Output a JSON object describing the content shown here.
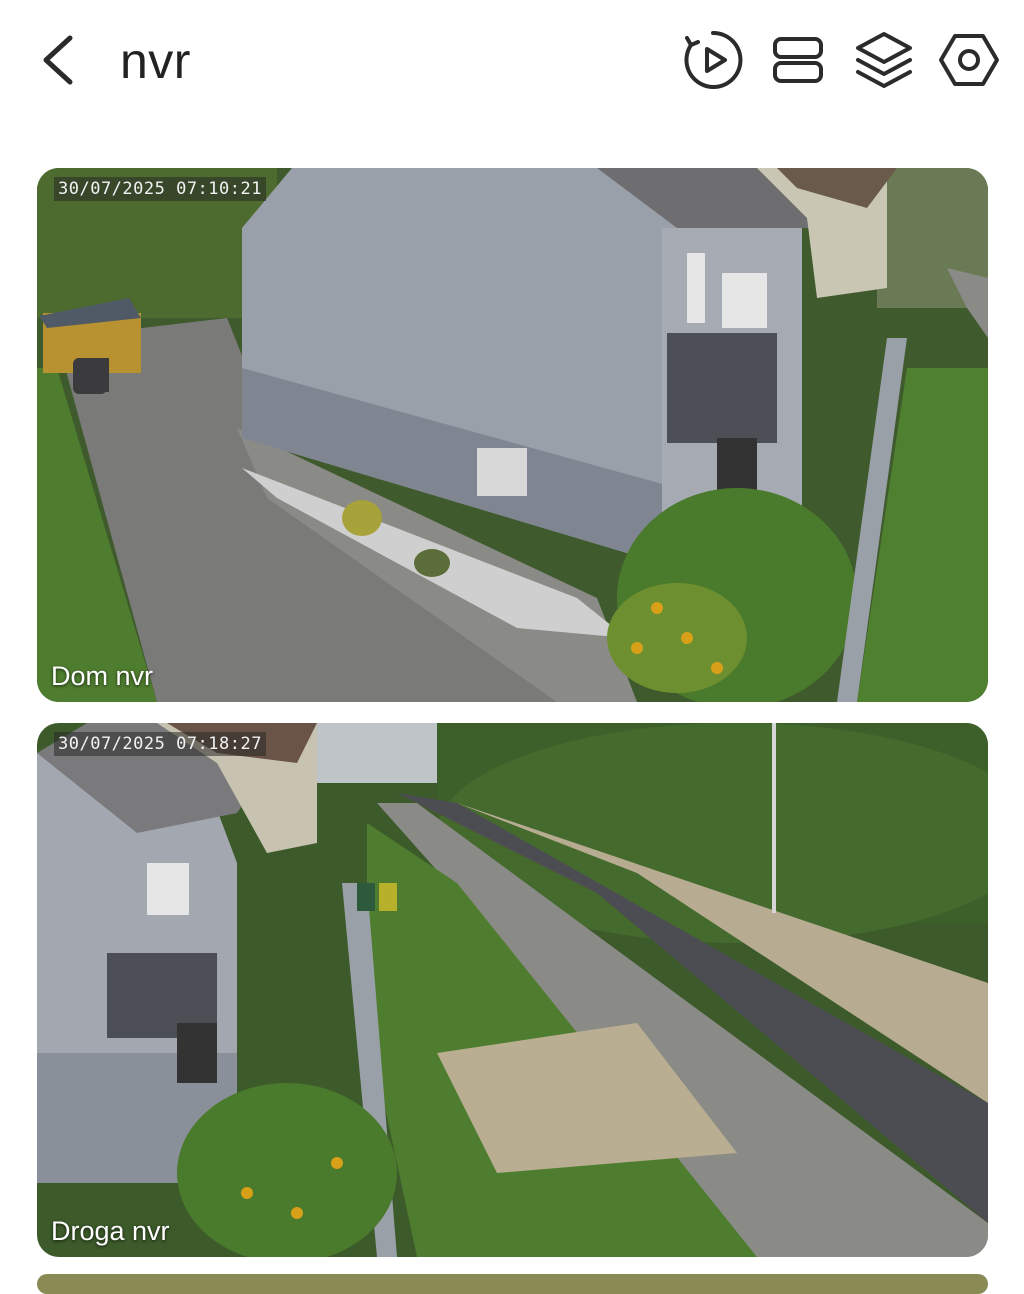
{
  "header": {
    "title": "nvr",
    "icons": [
      "back-arrow-icon",
      "playback-icon",
      "layout-icon",
      "layers-icon",
      "settings-icon"
    ]
  },
  "cameras": [
    {
      "name": "Dom nvr",
      "timestamp": "30/07/2025 07:10:21"
    },
    {
      "name": "Droga nvr",
      "timestamp": "30/07/2025 07:18:27"
    }
  ],
  "colors": {
    "icon": "#2b2b2b",
    "background": "#ffffff"
  }
}
